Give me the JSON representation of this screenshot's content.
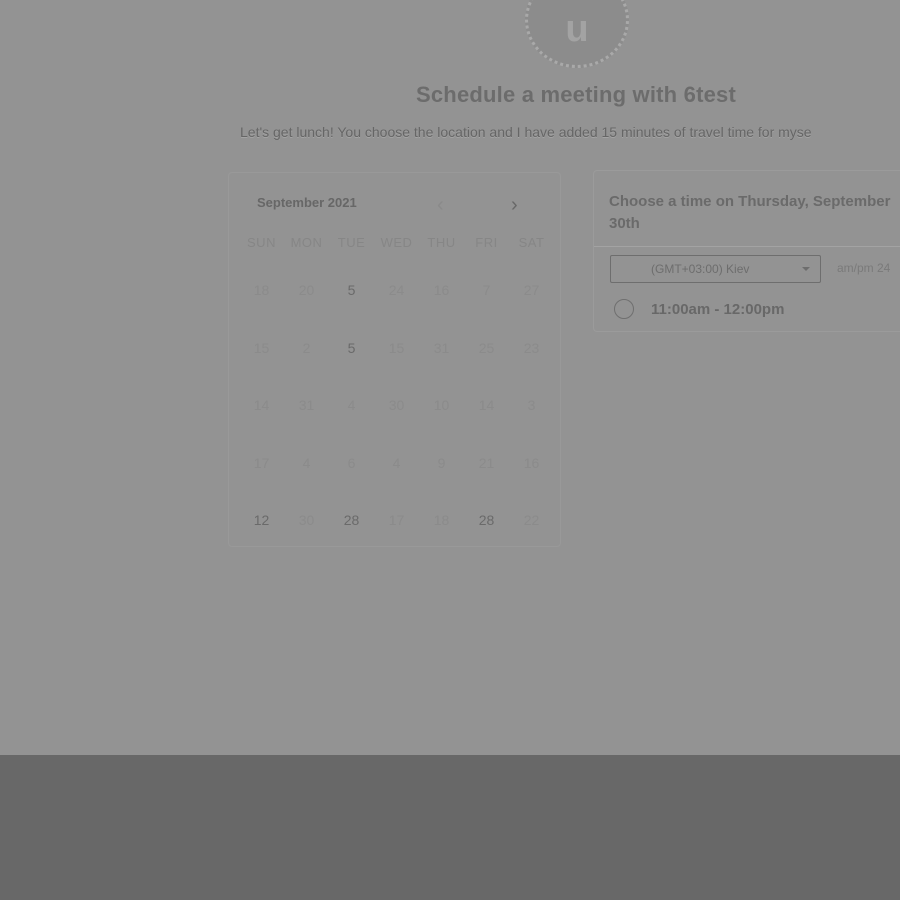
{
  "avatar": {
    "initial": "u"
  },
  "title": "Schedule a meeting with 6test",
  "subtitle": "Let's get lunch! You choose the location and I have added 15 minutes of travel time for myse",
  "calendar": {
    "month_label": "September 2021",
    "prev_icon": "chevron-left-icon",
    "next_icon": "chevron-right-icon",
    "weekdays": [
      "SUN",
      "MON",
      "TUE",
      "WED",
      "THU",
      "FRI",
      "SAT"
    ],
    "weeks": [
      [
        "18",
        "20",
        "5",
        "24",
        "16",
        "7",
        "27"
      ],
      [
        "15",
        "2",
        "5",
        "15",
        "31",
        "25",
        "23"
      ],
      [
        "14",
        "31",
        "4",
        "30",
        "10",
        "14",
        "3"
      ],
      [
        "17",
        "4",
        "6",
        "4",
        "9",
        "21",
        "16"
      ],
      [
        "12",
        "30",
        "28",
        "17",
        "18",
        "28",
        "22"
      ]
    ]
  },
  "time_panel": {
    "heading": "Choose a time on Thursday, September 30th",
    "timezone": "(GMT+03:00) Kiev",
    "time_format": "am/pm  24",
    "slots": [
      "11:00am - 12:00pm"
    ]
  }
}
